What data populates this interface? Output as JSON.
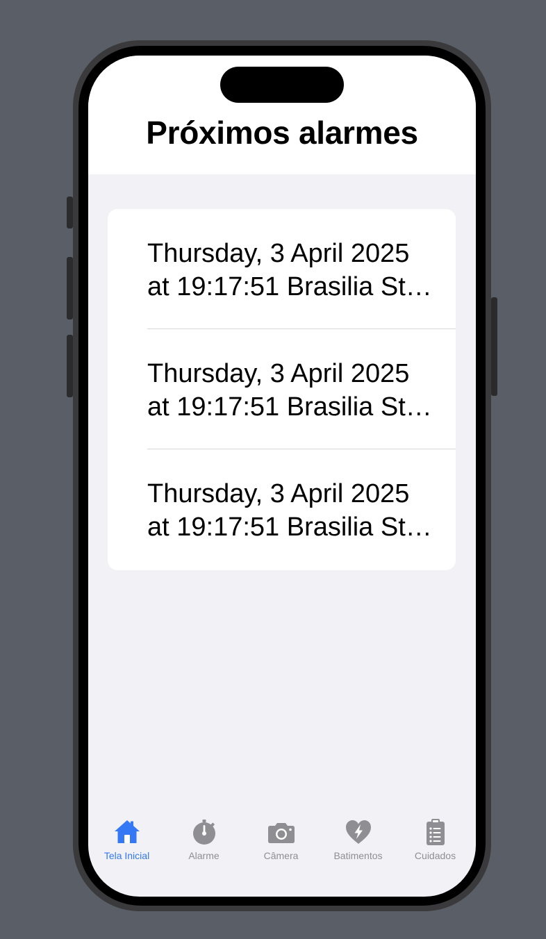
{
  "colors": {
    "accent": "#3478f6",
    "inactive": "#8e8e93",
    "background": "#f1f1f6"
  },
  "header": {
    "title": "Próximos alarmes"
  },
  "alarms": [
    {
      "line1": "Thursday, 3 April 2025",
      "line2": "at 19:17:51 Brasilia Sta..."
    },
    {
      "line1": "Thursday, 3 April 2025",
      "line2": "at 19:17:51 Brasilia Sta..."
    },
    {
      "line1": "Thursday, 3 April 2025",
      "line2": "at 19:17:51 Brasilia Sta..."
    }
  ],
  "tabs": [
    {
      "label": "Tela Inicial",
      "icon": "house-icon",
      "active": true
    },
    {
      "label": "Alarme",
      "icon": "stopwatch-icon",
      "active": false
    },
    {
      "label": "Câmera",
      "icon": "camera-icon",
      "active": false
    },
    {
      "label": "Batimentos",
      "icon": "heart-bolt-icon",
      "active": false
    },
    {
      "label": "Cuidados",
      "icon": "clipboard-list-icon",
      "active": false
    }
  ]
}
